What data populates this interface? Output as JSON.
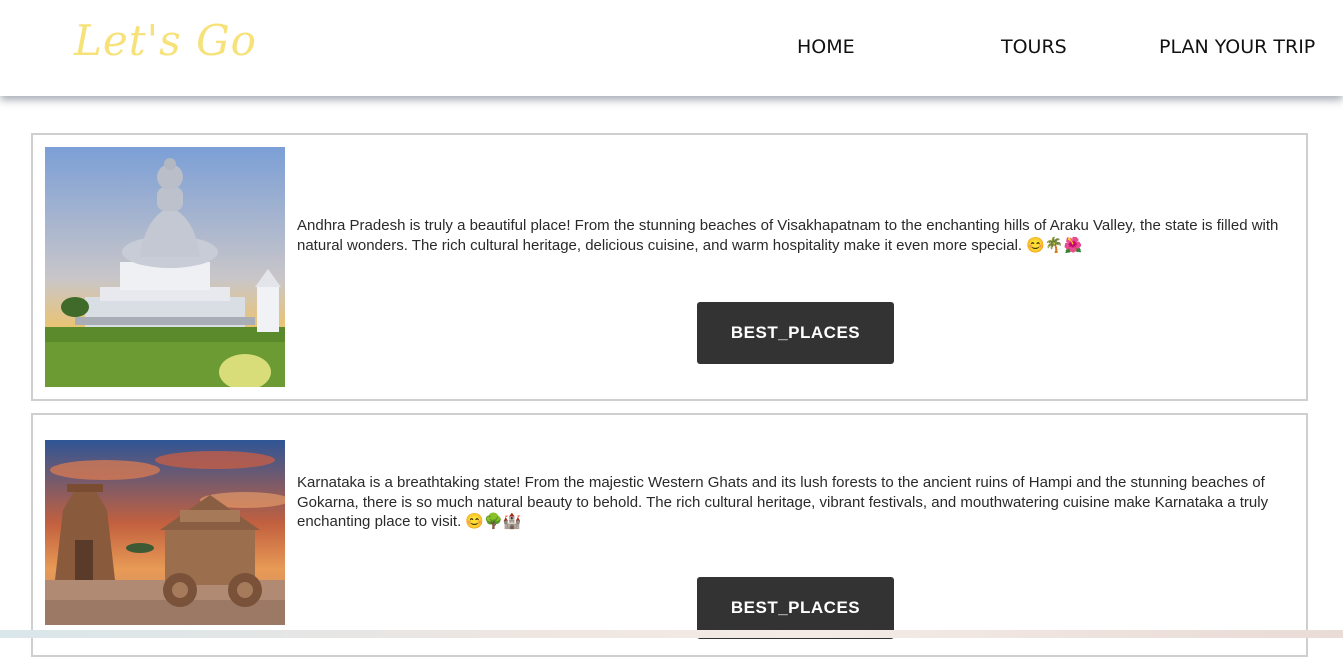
{
  "header": {
    "logo": "Let's Go",
    "nav": {
      "home": "HOME",
      "tours": "TOURS",
      "plan": "PLAN YOUR TRIP"
    }
  },
  "cards": [
    {
      "image_subject": "buddha-statue-photo",
      "text": "Andhra Pradesh is truly a beautiful place! From the stunning beaches of Visakhapatnam to the enchanting hills of Araku Valley, the state is filled with natural wonders. The rich cultural heritage, delicious cuisine, and warm hospitality make it even more special. 😊🌴🌺",
      "button": "BEST_PLACES"
    },
    {
      "image_subject": "hampi-stone-chariot-photo",
      "text": "Karnataka is a breathtaking state! From the majestic Western Ghats and its lush forests to the ancient ruins of Hampi and the stunning beaches of Gokarna, there is so much natural beauty to behold. The rich cultural heritage, vibrant festivals, and mouthwatering cuisine make Karnataka a truly enchanting place to visit. 😊🌳🏰",
      "button": "BEST_PLACES"
    }
  ],
  "colors": {
    "logo": "#f7e27a",
    "button_bg": "#333333",
    "button_text": "#ffffff",
    "card_border": "#cfcfcf"
  }
}
